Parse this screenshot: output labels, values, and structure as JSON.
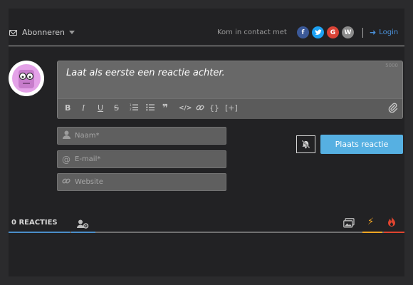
{
  "header": {
    "subscribe_label": "Abonneren",
    "contact_label": "Kom in contact met",
    "social": [
      {
        "name": "facebook",
        "glyph": "f",
        "color": "#3b5998"
      },
      {
        "name": "twitter",
        "glyph": "t",
        "color": "#1da1f2"
      },
      {
        "name": "google",
        "glyph": "G",
        "color": "#db4437"
      },
      {
        "name": "wordpress",
        "glyph": "W",
        "color": "#8b8b8b"
      }
    ],
    "login_label": "Login"
  },
  "editor": {
    "placeholder": "Laat als eerste een reactie achter.",
    "char_limit": "5000",
    "toolbar": [
      "B",
      "I",
      "U",
      "S",
      "ordered-list",
      "unordered-list",
      "quote",
      "code",
      "link",
      "{}",
      "[+]"
    ]
  },
  "form": {
    "name_placeholder": "Naam*",
    "email_placeholder": "E-mail*",
    "website_placeholder": "Website",
    "post_button": "Plaats reactie"
  },
  "tabs": {
    "count_label": "0 REACTIES"
  },
  "colors": {
    "accent": "#56b0e2",
    "login": "#4a90d9",
    "hot": "#f2a623",
    "popular": "#e0442f"
  }
}
